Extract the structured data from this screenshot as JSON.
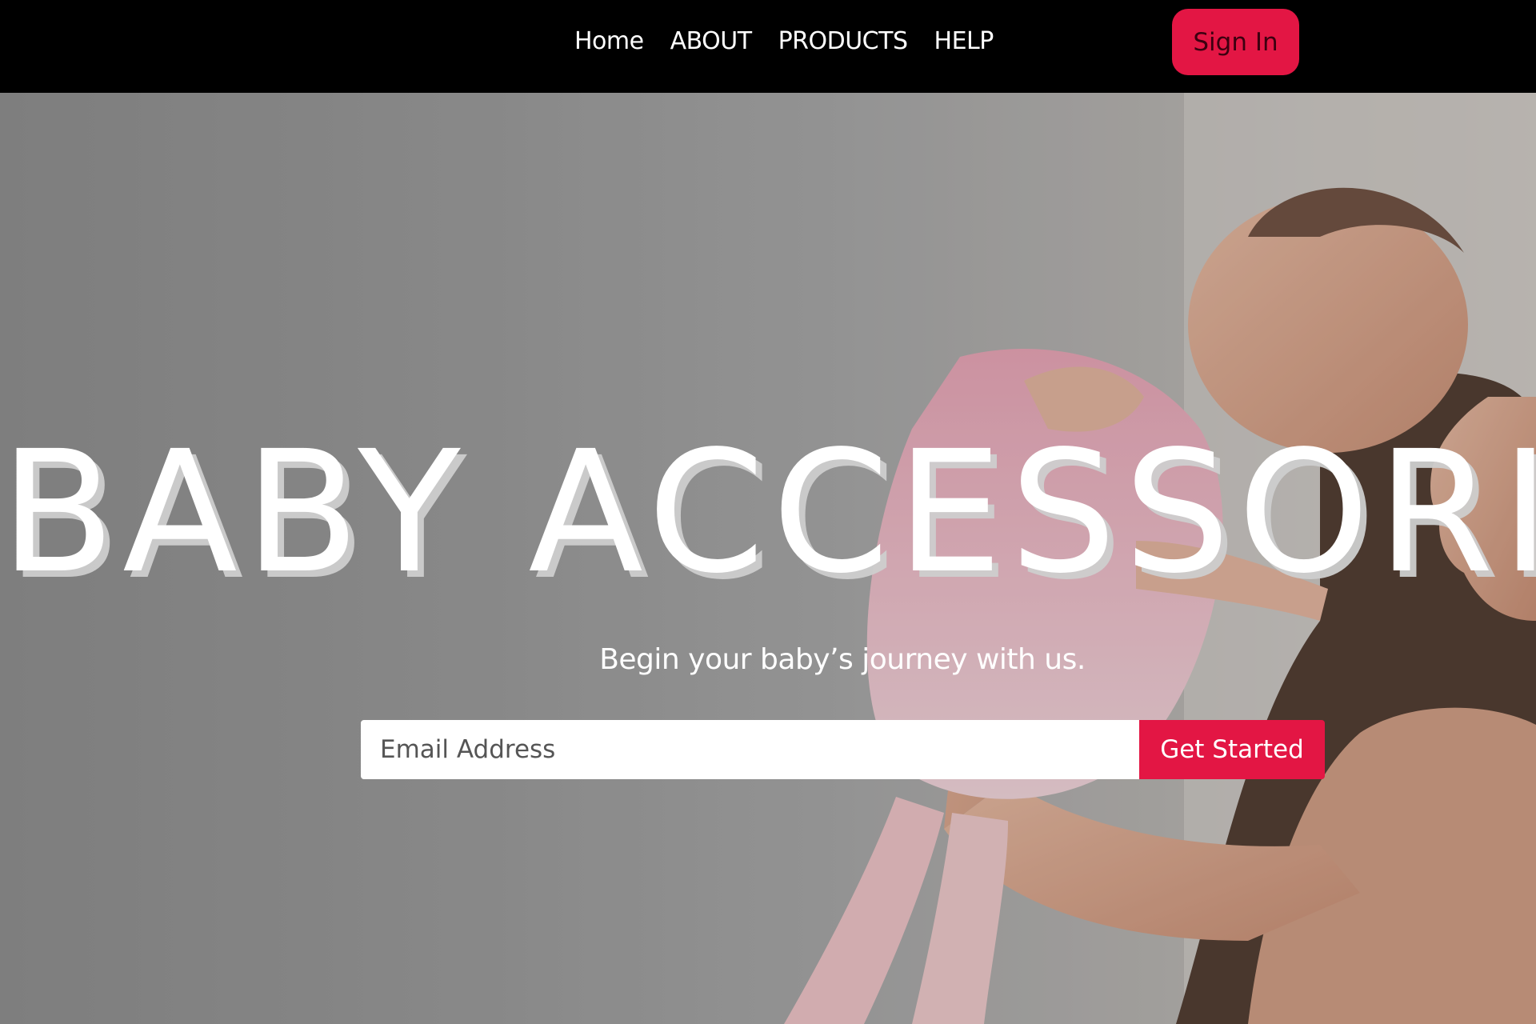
{
  "nav": {
    "links": [
      "Home",
      "ABOUT",
      "PRODUCTS",
      "HELP"
    ],
    "signin_label": "Sign In"
  },
  "hero": {
    "title": "BABY ACCESSORIES",
    "subtitle": "Begin your baby’s journey with us.",
    "background_image": "mother-lifting-baby-photo"
  },
  "signup": {
    "email_placeholder": "Email Address",
    "button_label": "Get Started"
  },
  "colors": {
    "accent": "#e31644",
    "navbar_bg": "#000000",
    "text_light": "#ffffff"
  }
}
